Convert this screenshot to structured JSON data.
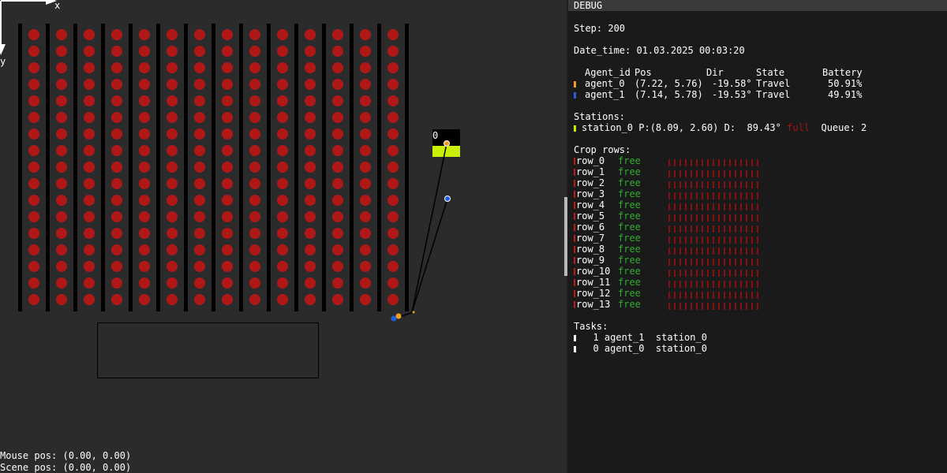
{
  "scene": {
    "axis_x_label": "x",
    "axis_y_label": "y",
    "station_label": "0",
    "mouse_pos": "Mouse pos: (0.00, 0.00)",
    "scene_pos": "Scene pos: (0.00, 0.00)",
    "colors": {
      "background": "#2b2b2b",
      "plant": "#b01818",
      "row_bar": "#000000",
      "station_fill": "#c8f000",
      "agent_0": "#f0a020",
      "agent_1": "#2060e0"
    }
  },
  "debug": {
    "header": "DEBUG",
    "step": "Step: 200",
    "date_time": "Date_time: 01.03.2025 00:03:20",
    "agents_header": {
      "id": "Agent_id",
      "pos": "Pos",
      "dir": "Dir",
      "state": "State",
      "battery": "Battery"
    },
    "agents": [
      {
        "id": "agent_0",
        "pos": "(7.22, 5.76)",
        "dir": "-19.58°",
        "state": "Travel",
        "battery": "50.91%",
        "color": "#f0a020"
      },
      {
        "id": "agent_1",
        "pos": "(7.14, 5.78)",
        "dir": "-19.53°",
        "state": "Travel",
        "battery": "49.91%",
        "color": "#2060e0"
      }
    ],
    "stations_header": "Stations:",
    "stations": [
      {
        "text": "station_0 P:(8.09, 2.60) D:  89.43°",
        "status": "full",
        "queue": "Queue: 2",
        "color": "#c8f000"
      }
    ],
    "crop_rows_header": "Crop rows:",
    "crop_rows": [
      {
        "name": "row_0",
        "status": "free"
      },
      {
        "name": "row_1",
        "status": "free"
      },
      {
        "name": "row_2",
        "status": "free"
      },
      {
        "name": "row_3",
        "status": "free"
      },
      {
        "name": "row_4",
        "status": "free"
      },
      {
        "name": "row_5",
        "status": "free"
      },
      {
        "name": "row_6",
        "status": "free"
      },
      {
        "name": "row_7",
        "status": "free"
      },
      {
        "name": "row_8",
        "status": "free"
      },
      {
        "name": "row_9",
        "status": "free"
      },
      {
        "name": "row_10",
        "status": "free"
      },
      {
        "name": "row_11",
        "status": "free"
      },
      {
        "name": "row_12",
        "status": "free"
      },
      {
        "name": "row_13",
        "status": "free"
      }
    ],
    "plants_per_row": 17,
    "tasks_header": "Tasks:",
    "tasks": [
      {
        "text": "  1 agent_1  station_0"
      },
      {
        "text": "  0 agent_0  station_0"
      }
    ]
  }
}
